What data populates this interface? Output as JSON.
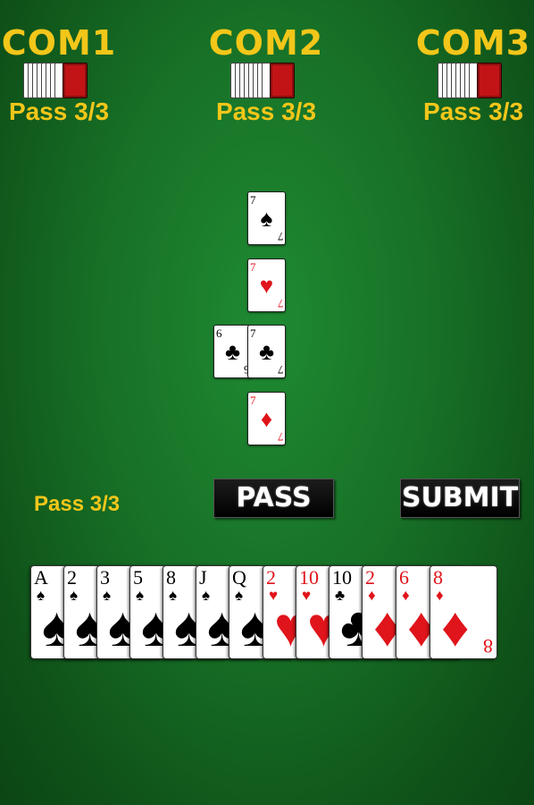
{
  "opponents": [
    {
      "name": "COM1",
      "status": "Pass 3/3"
    },
    {
      "name": "COM2",
      "status": "Pass 3/3"
    },
    {
      "name": "COM3",
      "status": "Pass 3/3"
    }
  ],
  "table_cards": [
    {
      "rank": "7",
      "suit": "♠",
      "color": "black"
    },
    {
      "rank": "7",
      "suit": "♥",
      "color": "red"
    },
    {
      "rank": "6",
      "suit": "♣",
      "color": "black"
    },
    {
      "rank": "7",
      "suit": "♣",
      "color": "black"
    },
    {
      "rank": "7",
      "suit": "♦",
      "color": "red"
    }
  ],
  "player": {
    "status": "Pass 3/3"
  },
  "buttons": {
    "pass_label": "PASS",
    "submit_label": "SUBMIT"
  },
  "hand": [
    {
      "rank": "A",
      "suit": "♠",
      "color": "black"
    },
    {
      "rank": "2",
      "suit": "♠",
      "color": "black"
    },
    {
      "rank": "3",
      "suit": "♠",
      "color": "black"
    },
    {
      "rank": "5",
      "suit": "♠",
      "color": "black"
    },
    {
      "rank": "8",
      "suit": "♠",
      "color": "black"
    },
    {
      "rank": "J",
      "suit": "♠",
      "color": "black"
    },
    {
      "rank": "Q",
      "suit": "♠",
      "color": "black"
    },
    {
      "rank": "2",
      "suit": "♥",
      "color": "red"
    },
    {
      "rank": "10",
      "suit": "♥",
      "color": "red"
    },
    {
      "rank": "10",
      "suit": "♣",
      "color": "black"
    },
    {
      "rank": "2",
      "suit": "♦",
      "color": "red"
    },
    {
      "rank": "6",
      "suit": "♦",
      "color": "red"
    },
    {
      "rank": "8",
      "suit": "♦",
      "color": "red",
      "bottom_rank": "8"
    }
  ],
  "colors": {
    "accent": "#f3c61a",
    "felt": "#177026",
    "card_back": "#c21417"
  }
}
